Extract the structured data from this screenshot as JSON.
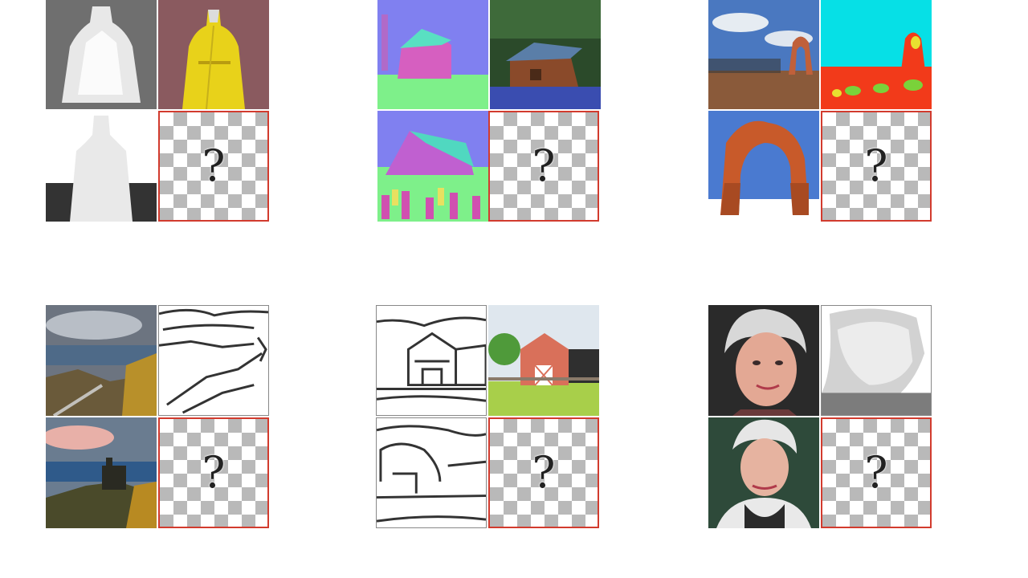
{
  "panels": [
    {
      "name": "robe-depth",
      "query_label": "?"
    },
    {
      "name": "cabin-normal",
      "query_label": "?"
    },
    {
      "name": "arches-segmentation",
      "query_label": "?"
    },
    {
      "name": "castle-edges",
      "query_label": "?"
    },
    {
      "name": "barn-edges",
      "query_label": "?"
    },
    {
      "name": "woman-depth",
      "query_label": "?"
    }
  ],
  "colors": {
    "query_border": "#d23b2e",
    "checker_dark": "#b9b9b9",
    "checker_light": "#ffffff"
  },
  "icons": {
    "query": "question-mark-icon"
  }
}
